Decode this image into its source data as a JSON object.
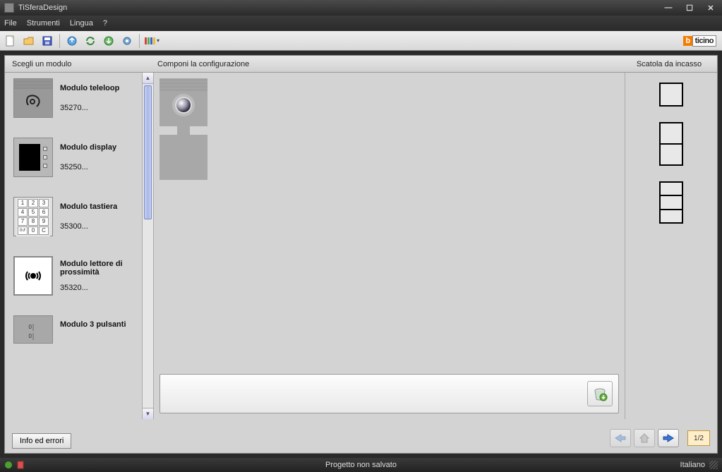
{
  "app": {
    "title": "TiSferaDesign"
  },
  "menu": {
    "file": "File",
    "tools": "Strumenti",
    "language": "Lingua",
    "help": "?"
  },
  "brand": {
    "badge": "b",
    "text": "ticino"
  },
  "columns": {
    "choose": "Scegli un modulo",
    "compose": "Componi la configurazione",
    "box": "Scatola da incasso"
  },
  "modules": [
    {
      "name": "Modulo teleloop",
      "code": "35270..."
    },
    {
      "name": "Modulo display",
      "code": "35250..."
    },
    {
      "name": "Modulo tastiera",
      "code": "35300..."
    },
    {
      "name": "Modulo lettore di prossimità",
      "code": "35320..."
    },
    {
      "name": "Modulo 3 pulsanti",
      "code": ""
    }
  ],
  "nav": {
    "page": "1/2"
  },
  "buttons": {
    "info": "Info ed errori"
  },
  "status": {
    "project": "Progetto non salvato",
    "language": "Italiano"
  },
  "keypad": [
    "1",
    "2",
    "3",
    "4",
    "5",
    "6",
    "7",
    "8",
    "9",
    "0↺",
    "0",
    "C"
  ]
}
